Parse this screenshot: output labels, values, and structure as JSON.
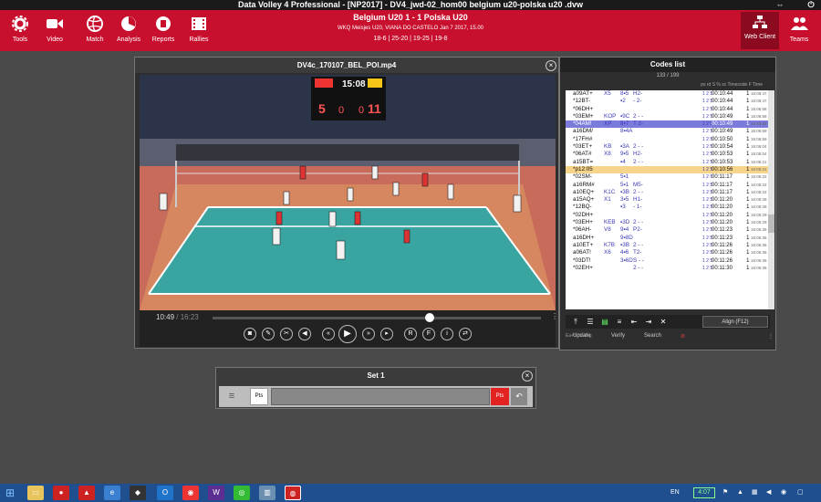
{
  "window": {
    "title": "Data Volley 4 Professional - [NP2017] - DV4_jwd-02_hom00 belgium u20-polska u20 .dvw"
  },
  "ribbon": {
    "items": [
      {
        "label": "Tools",
        "icon": "gear-icon"
      },
      {
        "label": "Video",
        "icon": "video-camera-icon"
      },
      {
        "label": "Match",
        "icon": "volleyball-icon"
      },
      {
        "label": "Analysis",
        "icon": "analysis-pie-icon"
      },
      {
        "label": "Reports",
        "icon": "report-document-icon"
      },
      {
        "label": "Rallies",
        "icon": "film-strip-icon"
      }
    ],
    "web_client": "Web Client",
    "teams": "Teams"
  },
  "match": {
    "teams_score": "Belgium U20  1 - 1  Polska U20",
    "details": "WKQ Meisjes U20, VIANA DO CASTELO Jan 7 2017, 15.00",
    "sets": "18-6 | 25-20 | 19-25 | 19-8"
  },
  "video_window": {
    "title": "DV4c_170107_BEL_POl.mp4",
    "time_current": "10:49",
    "time_total": "/ 16:23",
    "progress": 0.66,
    "scoreboard": {
      "home_score": "5",
      "away_score": "11",
      "clock": "15:08",
      "sets_home": "0",
      "sets_away": "0"
    }
  },
  "codes_list": {
    "title": "Codes list",
    "count": "133 / 199",
    "header": "ps rd S % sc  Timecode  F  Time",
    "rows": [
      {
        "code": "a09AT+",
        "c2": "X5",
        "c3": "8▪5",
        "c4": "H2-",
        "c5": "1 2 5",
        "time": "00:10:44",
        "f": "1",
        "w": "16:06:47",
        "state": ""
      },
      {
        "code": "*12BT-",
        "c2": "",
        "c3": "▪2",
        "c4": "- 2-",
        "c5": "1 2 5",
        "time": "00:10:44",
        "f": "1",
        "w": "16:06:47",
        "state": ""
      },
      {
        "code": "*06DH+",
        "c2": "",
        "c3": "",
        "c4": "",
        "c5": "1 2 5",
        "time": "00:10:44",
        "f": "1",
        "w": "16:06:58",
        "state": ""
      },
      {
        "code": "*03EM+",
        "c2": "KOP",
        "c3": "▪9C",
        "c4": "2 - -",
        "c5": "1 2 5",
        "time": "00:10:49",
        "f": "1",
        "w": "16:06:58",
        "state": ""
      },
      {
        "code": "*04AM!",
        "c2": "XP",
        "c3": "8▪7",
        "c4": "T 2-",
        "c5": "1 2 5",
        "time": "00:10:49",
        "f": "1",
        "w": "16:06:58",
        "state": "sel"
      },
      {
        "code": "a16DM/",
        "c2": "",
        "c3": "8▪4A",
        "c4": "",
        "c5": "1 2 5",
        "time": "00:10:49",
        "f": "1",
        "w": "16:06:59",
        "state": ""
      },
      {
        "code": "*17FH#",
        "c2": "",
        "c3": "",
        "c4": "",
        "c5": "1 2 5",
        "time": "00:10:50",
        "f": "1",
        "w": "16:06:59",
        "state": ""
      },
      {
        "code": "*03ET+",
        "c2": "KB",
        "c3": "▪3A",
        "c4": "2 - -",
        "c5": "1 2 5",
        "time": "00:10:54",
        "f": "1",
        "w": "16:06:04",
        "state": ""
      },
      {
        "code": "*06AT#",
        "c2": "X8",
        "c3": "9▪5",
        "c4": "H2-",
        "c5": "1 2 5",
        "time": "00:10:53",
        "f": "1",
        "w": "16:06:04",
        "state": ""
      },
      {
        "code": "a15BT=",
        "c2": "",
        "c3": "▪4",
        "c4": "2 - -",
        "c5": "1 2 5",
        "time": "00:10:53",
        "f": "1",
        "w": "16:06:21",
        "state": ""
      },
      {
        "code": "*p12:05",
        "c2": "",
        "c3": "",
        "c4": "",
        "c5": "1 2 5",
        "time": "00:10:56",
        "f": "1",
        "w": "16:06:21",
        "state": "hl"
      },
      {
        "code": "*02SM-",
        "c2": "",
        "c3": "5▪1",
        "c4": "",
        "c5": "1 2 5",
        "time": "00:11:17",
        "f": "1",
        "w": "16:06:22",
        "state": ""
      },
      {
        "code": "a16RM#",
        "c2": "",
        "c3": "5▪1",
        "c4": "M5-",
        "c5": "1 2 5",
        "time": "00:11:17",
        "f": "1",
        "w": "16:06:22",
        "state": ""
      },
      {
        "code": "a10EQ+",
        "c2": "K1C",
        "c3": "▪3B",
        "c4": "2 - -",
        "c5": "1 2 5",
        "time": "00:11:17",
        "f": "1",
        "w": "16:06:22",
        "state": ""
      },
      {
        "code": "a15AQ+",
        "c2": "X1",
        "c3": "3▪5",
        "c4": "H1-",
        "c5": "1 2 5",
        "time": "00:11:20",
        "f": "1",
        "w": "16:06:28",
        "state": ""
      },
      {
        "code": "*12BQ-",
        "c2": "",
        "c3": "▪3",
        "c4": "- 1-",
        "c5": "1 2 5",
        "time": "00:11:20",
        "f": "1",
        "w": "16:06:28",
        "state": ""
      },
      {
        "code": "*02DH+",
        "c2": "",
        "c3": "",
        "c4": "",
        "c5": "1 2 5",
        "time": "00:11:20",
        "f": "1",
        "w": "16:06:29",
        "state": ""
      },
      {
        "code": "*03EH+",
        "c2": "KEB",
        "c3": "▪3D",
        "c4": "2 - -",
        "c5": "1 2 5",
        "time": "00:11:20",
        "f": "1",
        "w": "16:06:29",
        "state": ""
      },
      {
        "code": "*06AH-",
        "c2": "V8",
        "c3": "9▪4",
        "c4": "P2-",
        "c5": "1 2 5",
        "time": "00:11:23",
        "f": "1",
        "w": "16:06:36",
        "state": ""
      },
      {
        "code": "a16DH+",
        "c2": "",
        "c3": "9▪8D",
        "c4": "",
        "c5": "1 2 5",
        "time": "00:11:23",
        "f": "1",
        "w": "16:06:36",
        "state": ""
      },
      {
        "code": "a10ET+",
        "c2": "K7B",
        "c3": "▪3B",
        "c4": "2 - -",
        "c5": "1 2 5",
        "time": "00:11:26",
        "f": "1",
        "w": "16:06:36",
        "state": ""
      },
      {
        "code": "a06AT!",
        "c2": "X6",
        "c3": "4▪6",
        "c4": "T2-",
        "c5": "1 2 5",
        "time": "00:11:26",
        "f": "1",
        "w": "16:06:36",
        "state": ""
      },
      {
        "code": "*03DT!",
        "c2": "",
        "c3": "3▪6D",
        "c4": "S - -",
        "c5": "1 2 5",
        "time": "00:11:26",
        "f": "1",
        "w": "16:06:36",
        "state": ""
      },
      {
        "code": "*02EH+",
        "c2": "",
        "c3": "",
        "c4": "2 - -",
        "c5": "1 2 5",
        "time": "00:11:30",
        "f": "1",
        "w": "16:06:36",
        "state": ""
      }
    ],
    "align_button": "Align (F12)",
    "actions": {
      "update": "Update",
      "verify": "Verify",
      "search": "Search",
      "sub": "Ea+Scouting"
    }
  },
  "set_panel": {
    "title": "Set 1",
    "pts_left": "Pts",
    "pts_right": "Pts"
  },
  "taskbar": {
    "language": "EN",
    "battery": "4:07"
  },
  "colors": {
    "ribbon": "#c8102e",
    "selected_row": "#7b7bdc",
    "highlight_row": "#f6d48a"
  }
}
